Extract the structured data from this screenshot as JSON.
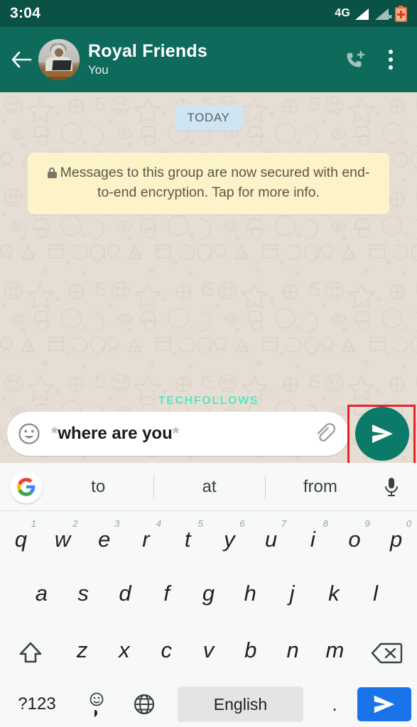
{
  "status_bar": {
    "time": "3:04",
    "network": "4G",
    "icons": [
      "signal-full-icon",
      "signal-no-service-icon",
      "battery-charging-icon"
    ]
  },
  "header": {
    "back_icon": "back-arrow-icon",
    "avatar": "group-avatar",
    "title": "Royal Friends",
    "subtitle": "You",
    "call_icon": "add-call-icon",
    "menu_icon": "overflow-menu-icon",
    "bg_color": "#0E6B5B"
  },
  "chat": {
    "date_divider": "TODAY",
    "encryption_notice": "Messages to this group are now secured with end-to-end encryption. Tap for more info.",
    "lock_icon": "lock-icon",
    "watermark": "TECHFOLLOWS",
    "watermark_color": "#5BE6BE",
    "bg_color": "#E6DED5"
  },
  "composer": {
    "emoji_icon": "emoji-smiley-icon",
    "text_prefix": "*",
    "text_body": "where are you",
    "text_suffix": "*",
    "attach_icon": "paperclip-icon",
    "send_icon": "send-icon",
    "send_color": "#0C7A68",
    "highlight_color": "#EC2128"
  },
  "keyboard": {
    "suggestions": {
      "logo": "google-logo-icon",
      "items": [
        "to",
        "at",
        "from"
      ],
      "mic_icon": "microphone-icon"
    },
    "row1": [
      {
        "key": "q",
        "num": "1"
      },
      {
        "key": "w",
        "num": "2"
      },
      {
        "key": "e",
        "num": "3"
      },
      {
        "key": "r",
        "num": "4"
      },
      {
        "key": "t",
        "num": "5"
      },
      {
        "key": "y",
        "num": "6"
      },
      {
        "key": "u",
        "num": "7"
      },
      {
        "key": "i",
        "num": "8"
      },
      {
        "key": "o",
        "num": "9"
      },
      {
        "key": "p",
        "num": "0"
      }
    ],
    "row2": [
      "a",
      "s",
      "d",
      "f",
      "g",
      "h",
      "j",
      "k",
      "l"
    ],
    "row3": [
      "z",
      "x",
      "c",
      "v",
      "b",
      "n",
      "m"
    ],
    "shift_icon": "shift-icon",
    "backspace_icon": "backspace-icon",
    "row4": {
      "symbols": "?123",
      "emoji_icon": "emoji-comma-key",
      "comma": ",",
      "globe_icon": "language-globe-icon",
      "space_label": "English",
      "period": ".",
      "send_icon": "send-key-icon",
      "send_color": "#1A73E8"
    }
  }
}
